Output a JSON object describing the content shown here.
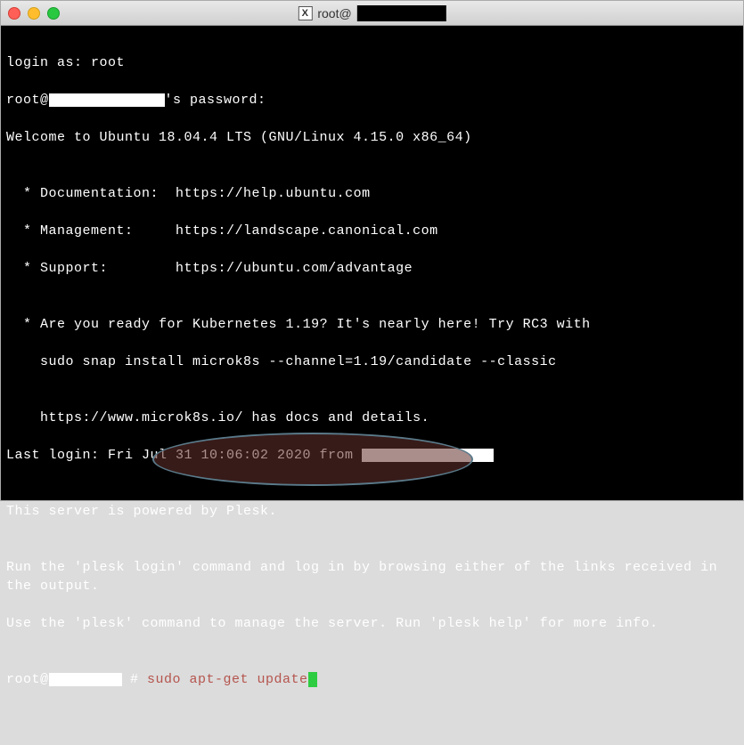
{
  "titlebar": {
    "title_prefix": "root@"
  },
  "terminal": {
    "login_as": "login as: root",
    "root_at": "root@",
    "password_suffix": "'s password:",
    "welcome": "Welcome to Ubuntu 18.04.4 LTS (GNU/Linux 4.15.0 x86_64)",
    "blank": "",
    "doc_line": "  * Documentation:  https://help.ubuntu.com",
    "mgmt_line": "  * Management:     https://landscape.canonical.com",
    "support_line": "  * Support:        https://ubuntu.com/advantage",
    "k8s_line1": "  * Are you ready for Kubernetes 1.19? It's nearly here! Try RC3 with",
    "k8s_line2": "    sudo snap install microk8s --channel=1.19/candidate --classic",
    "k8s_line3": "    https://www.microk8s.io/ has docs and details.",
    "last_login_prefix": "Last login: Fri Jul 31 10:06:02 2020 from ",
    "plesk_powered": "This server is powered by Plesk.",
    "plesk_login": "Run the 'plesk login' command and log in by browsing either of the links received in the output.",
    "plesk_manage": "Use the 'plesk' command to manage the server. Run 'plesk help' for more info.",
    "prompt_root": "root@",
    "prompt_hash": " # ",
    "command": "sudo apt-get update"
  }
}
